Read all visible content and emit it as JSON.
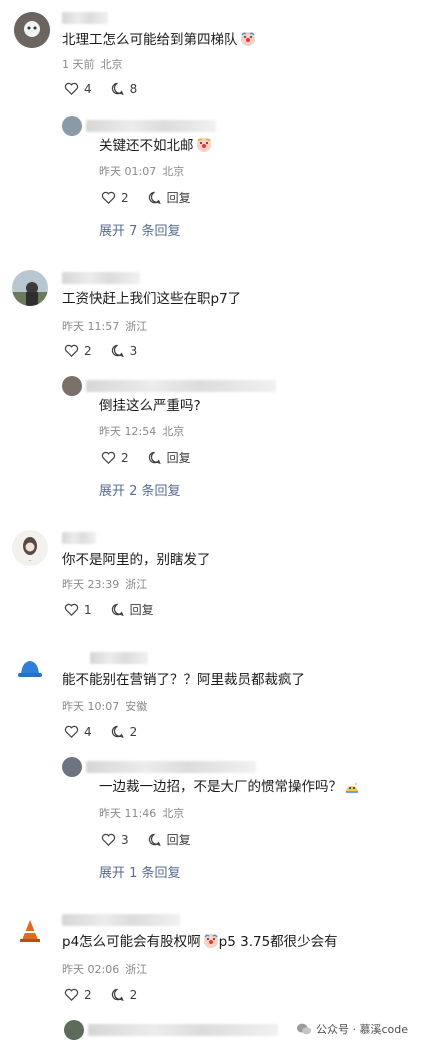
{
  "comments": [
    {
      "text": "北理工怎么可能给到第四梯队",
      "emoji": "clown-face-icon",
      "meta": {
        "time": "1 天前",
        "location": "北京"
      },
      "likes": "4",
      "replies": "8",
      "reply": {
        "text": "关键还不如北邮",
        "emoji": "clown-face-icon",
        "meta": {
          "time": "昨天 01:07",
          "location": "北京"
        },
        "likes": "2",
        "reply_label": "回复"
      },
      "expand_label": "展开 7 条回复"
    },
    {
      "text": "工资快赶上我们这些在职p7了",
      "meta": {
        "time": "昨天 11:57",
        "location": "浙江"
      },
      "likes": "2",
      "replies": "3",
      "reply": {
        "text": "倒挂这么严重吗?",
        "meta": {
          "time": "昨天 12:54",
          "location": "北京"
        },
        "likes": "2",
        "reply_label": "回复"
      },
      "expand_label": "展开 2 条回复"
    },
    {
      "text": "你不是阿里的，别瞎发了",
      "meta": {
        "time": "昨天 23:39",
        "location": "浙江"
      },
      "likes": "1",
      "reply_label": "回复"
    },
    {
      "text": "能不能别在营销了？？阿里裁员都裁疯了",
      "meta": {
        "time": "昨天 10:07",
        "location": "安徽"
      },
      "likes": "4",
      "replies": "2",
      "reply": {
        "text": "一边裁一边招，不是大厂的惯常操作吗？",
        "emoji": "sweat-face-icon",
        "meta": {
          "time": "昨天 11:46",
          "location": "北京"
        },
        "likes": "3",
        "reply_label": "回复"
      },
      "expand_label": "展开 1 条回复"
    },
    {
      "text": "p4怎么可能会有股权啊",
      "text2": "p5 3.75都很少会有",
      "emoji": "clown-face-icon",
      "meta": {
        "time": "昨天 02:06",
        "location": "浙江"
      },
      "likes": "2",
      "replies": "2"
    }
  ],
  "watermark": {
    "text": "公众号 · 慕溪code",
    "icon": "wechat-icon"
  }
}
